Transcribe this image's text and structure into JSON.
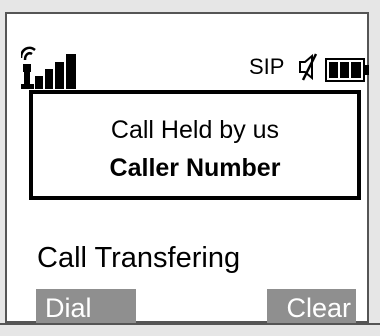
{
  "status": {
    "protocol_label": "SIP",
    "icons": [
      "signal-strength-icon",
      "mute-speaker-icon",
      "battery-full-icon"
    ]
  },
  "call": {
    "status_text": "Call Held by us",
    "caller_label": "Caller Number",
    "transfer_text": "Call Transfering"
  },
  "softkeys": {
    "left_label": "Dial",
    "right_label": "Clear"
  },
  "colors": {
    "screen_bg": "#ffffff",
    "bezel": "#e6e6e6",
    "softkey_bg": "#8f8f8f",
    "softkey_text": "#ffffff"
  }
}
